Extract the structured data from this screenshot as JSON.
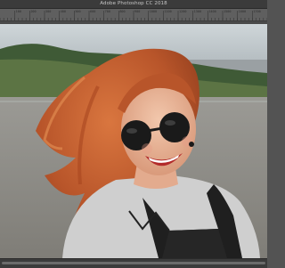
{
  "window": {
    "title": "Adobe Photoshop CC 2018"
  },
  "ruler": {
    "ticks": [
      "100",
      "200",
      "300",
      "400",
      "500",
      "600",
      "700",
      "800",
      "900",
      "1000",
      "1100",
      "1200",
      "1300",
      "1400",
      "1500",
      "1600",
      "1700"
    ]
  },
  "canvas": {
    "image_description_icon": "photo-portrait"
  },
  "colors": {
    "chrome_dark": "#3b3b3b",
    "ruler_bg": "#5f5f5f",
    "title_text": "#c8c8c8"
  }
}
